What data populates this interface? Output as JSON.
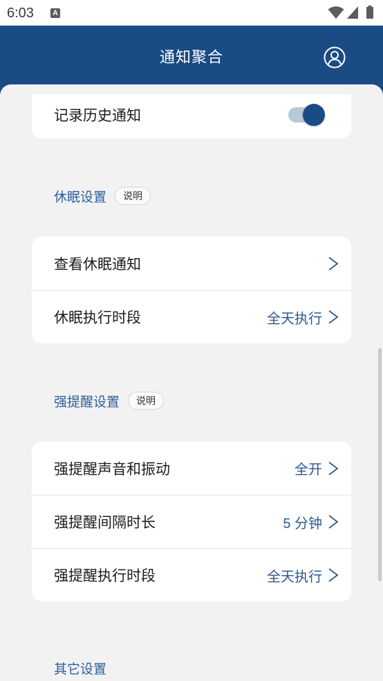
{
  "status_bar": {
    "time": "6:03",
    "notification_glyph": "A",
    "icons": [
      "wifi-icon",
      "signal-icon",
      "battery-icon"
    ]
  },
  "header": {
    "title": "通知聚合",
    "profile_icon": "account-circle-icon"
  },
  "history": {
    "label": "记录历史通知",
    "enabled": true
  },
  "sleep_section": {
    "title": "休眠设置",
    "info_label": "说明",
    "rows": [
      {
        "label": "查看休眠通知",
        "value": ""
      },
      {
        "label": "休眠执行时段",
        "value": "全天执行"
      }
    ]
  },
  "strong_section": {
    "title": "强提醒设置",
    "info_label": "说明",
    "rows": [
      {
        "label": "强提醒声音和振动",
        "value": "全开"
      },
      {
        "label": "强提醒间隔时长",
        "value": "5 分钟"
      },
      {
        "label": "强提醒执行时段",
        "value": "全天执行"
      }
    ]
  },
  "other_section": {
    "title": "其它设置"
  },
  "colors": {
    "header": "#1b4b84",
    "accent_text": "#2c5a8e",
    "section_title": "#2e5f97",
    "background": "#f2f2f3",
    "toggle_track": "#b8c7d9"
  }
}
